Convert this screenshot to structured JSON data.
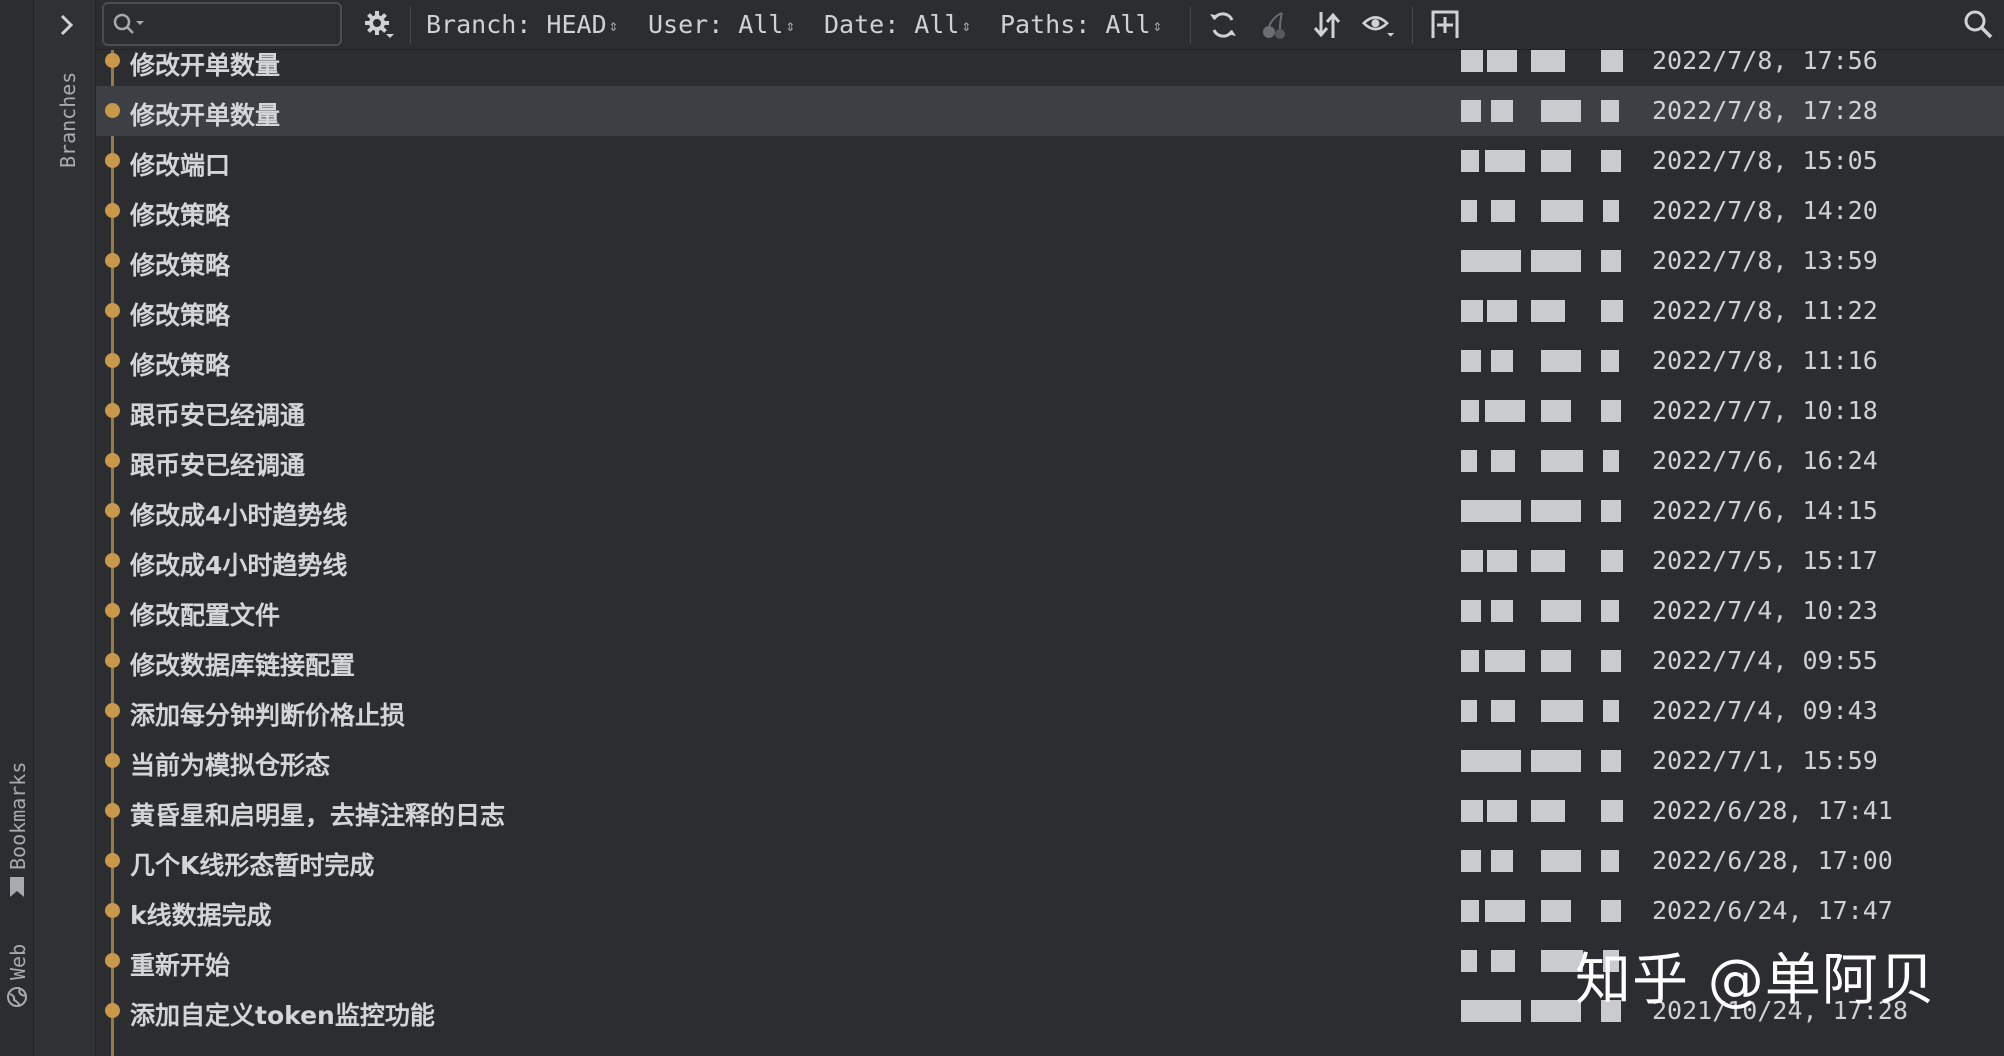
{
  "sidebar": {
    "branches_label": "Branches",
    "bookmarks_label": "Bookmarks",
    "web_label": "Web"
  },
  "toolbar": {
    "search_placeholder": "",
    "filters": {
      "branch": "Branch: HEAD",
      "user": "User: All",
      "date": "Date: All",
      "paths": "Paths: All"
    },
    "icons": [
      "settings-icon",
      "refresh-icon",
      "cherry-pick-icon",
      "sort-icon",
      "eye-icon",
      "new-tab-icon",
      "search-icon"
    ]
  },
  "colors": {
    "background": "#2b2d30",
    "selected_row": "#3c3f44",
    "graph": "#c8994a"
  },
  "commits": [
    {
      "message": "修改开单数量",
      "date": "2022/7/8, 17:56"
    },
    {
      "message": "修改开单数量",
      "date": "2022/7/8, 17:28"
    },
    {
      "message": "修改端口",
      "date": "2022/7/8, 15:05"
    },
    {
      "message": "修改策略",
      "date": "2022/7/8, 14:20"
    },
    {
      "message": "修改策略",
      "date": "2022/7/8, 13:59"
    },
    {
      "message": "修改策略",
      "date": "2022/7/8, 11:22"
    },
    {
      "message": "修改策略",
      "date": "2022/7/8, 11:16"
    },
    {
      "message": "跟币安已经调通",
      "date": "2022/7/7, 10:18"
    },
    {
      "message": "跟币安已经调通",
      "date": "2022/7/6, 16:24"
    },
    {
      "message": "修改成4小时趋势线",
      "date": "2022/7/6, 14:15"
    },
    {
      "message": "修改成4小时趋势线",
      "date": "2022/7/5, 15:17"
    },
    {
      "message": "修改配置文件",
      "date": "2022/7/4, 10:23"
    },
    {
      "message": "修改数据库链接配置",
      "date": "2022/7/4, 09:55"
    },
    {
      "message": "添加每分钟判断价格止损",
      "date": "2022/7/4, 09:43"
    },
    {
      "message": "当前为模拟仓形态",
      "date": "2022/7/1, 15:59"
    },
    {
      "message": "黄昏星和启明星，去掉注释的日志",
      "date": "2022/6/28, 17:41"
    },
    {
      "message": "几个K线形态暂时完成",
      "date": "2022/6/28, 17:00"
    },
    {
      "message": "k线数据完成",
      "date": "2022/6/24, 17:47"
    },
    {
      "message": "重新开始",
      "date": ""
    },
    {
      "message": "添加自定义token监控功能",
      "date": "2021/10/24, 17:28"
    }
  ],
  "selected_index": 1,
  "watermark": "知乎 @单阿贝"
}
